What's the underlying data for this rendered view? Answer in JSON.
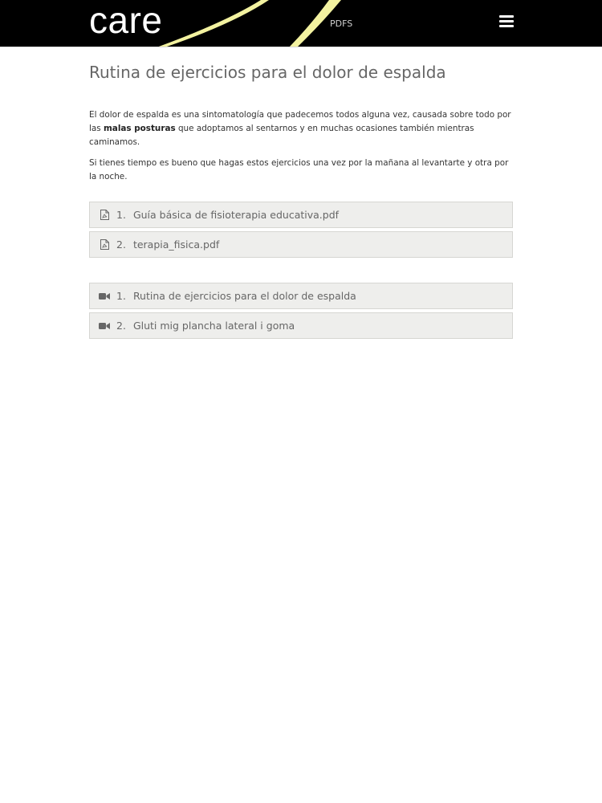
{
  "header": {
    "logo_text": "care",
    "nav_link": "PDFS",
    "accent_color": "#f3f2a0"
  },
  "page": {
    "title": "Rutina de ejercicios para el dolor de espalda",
    "intro_p1_before": "El dolor de espalda es una sintomatología que padecemos todos alguna vez, causada sobre todo por las ",
    "intro_p1_bold": "malas posturas",
    "intro_p1_after": " que adoptamos al sentarnos y en muchas ocasiones también mientras caminamos.",
    "intro_p2": "Si tienes tiempo es bueno que hagas estos ejercicios una vez por la mañana al levantarte y otra por la noche."
  },
  "pdfs": [
    {
      "num": "1.",
      "label": "Guía básica de fisioterapia educativa.pdf",
      "icon": "pdf-file-icon"
    },
    {
      "num": "2.",
      "label": "terapia_fisica.pdf",
      "icon": "pdf-file-icon"
    }
  ],
  "videos": [
    {
      "num": "1.",
      "label": "Rutina de ejercicios para el dolor de espalda",
      "icon": "video-camera-icon"
    },
    {
      "num": "2.",
      "label": "Gluti mig plancha lateral i goma",
      "icon": "video-camera-icon"
    }
  ]
}
